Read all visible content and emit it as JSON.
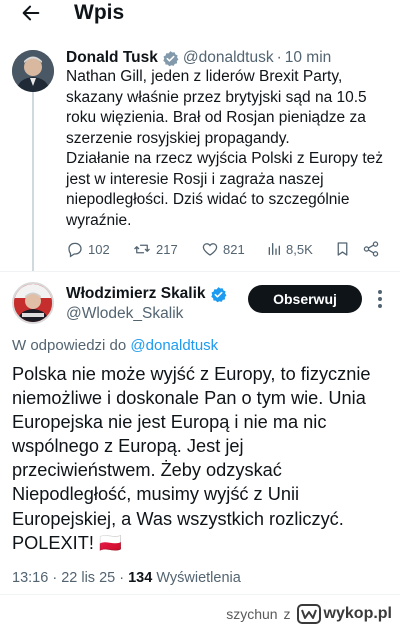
{
  "header": {
    "title": "Wpis",
    "back_icon": "arrow-left-icon"
  },
  "tweet": {
    "author_name": "Donald Tusk",
    "handle": "@donaldtusk",
    "separator": "·",
    "time": "10 min",
    "body": "Nathan Gill, jeden z liderów Brexit Party, skazany właśnie przez brytyjski sąd na 10.5 roku więzienia. Brał od Rosjan pieniądze za szerzenie rosyjskiej propagandy.\nDziałanie na rzecz wyjścia Polski z Europy też jest w interesie Rosji i zagraża naszej niepodległości. Dziś widać to szczególnie wyraźnie.",
    "actions": {
      "replies": "102",
      "reposts": "217",
      "likes": "821",
      "views": "8,5K"
    }
  },
  "reply": {
    "author_name": "Włodzimierz Skalik",
    "handle": "@Wlodek_Skalik",
    "follow_label": "Obserwuj",
    "reply_to_prefix": "W odpowiedzi do",
    "reply_to_mention": "@donaldtusk",
    "body": "Polska nie może wyjść z Europy, to fizycznie niemożliwe i doskonale Pan o tym wie. Unia Europejska nie jest Europą i nie ma nic wspólnego z Europą. Jest jej przeciwieństwem. Żeby odzyskać Niepodległość, musimy wyjść z Unii Europejskiej, a Was wszystkich rozliczyć. POLEXIT!",
    "flag": "🇵🇱",
    "time": "13:16",
    "date": "22 lis 25",
    "views_count": "134",
    "views_label": "Wyświetlenia"
  },
  "watermark": {
    "user": "szychun",
    "connector": "z",
    "site": "wykop.pl"
  },
  "colors": {
    "accent": "#1d9bf0",
    "text": "#0f1419",
    "secondary": "#536471",
    "flag_red": "#dc143c"
  }
}
